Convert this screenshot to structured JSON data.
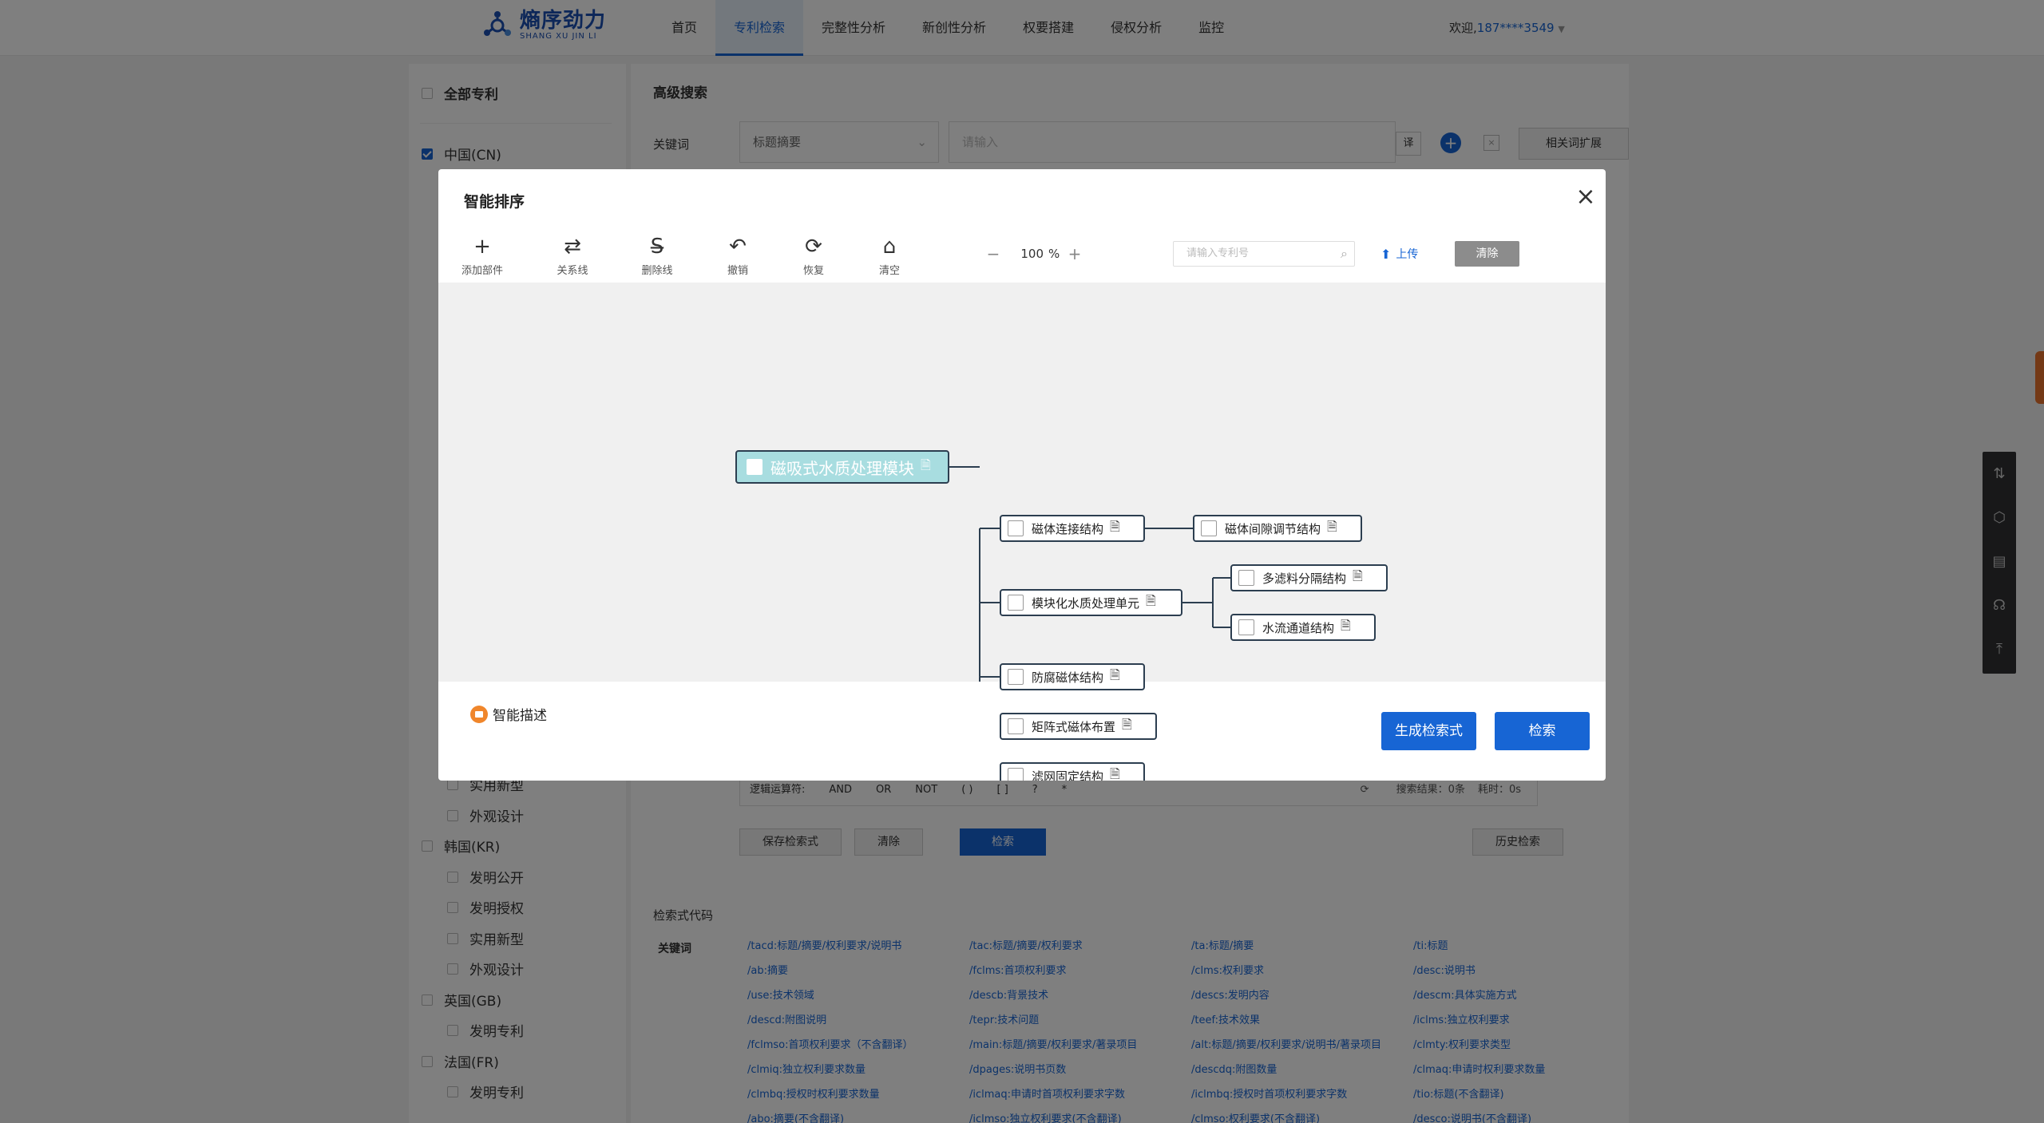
{
  "header": {
    "logo_cn": "熵序劲力",
    "logo_en": "SHANG XU JIN LI",
    "nav": [
      "首页",
      "专利检索",
      "完整性分析",
      "新创性分析",
      "权要搭建",
      "侵权分析",
      "监控"
    ],
    "welcome": "欢迎,",
    "user": "187****3549"
  },
  "sidebar": {
    "all": "全部专利",
    "cn": "中国(CN)",
    "items_lower": [
      {
        "label": "实用新型",
        "indent": true
      },
      {
        "label": "外观设计",
        "indent": true
      },
      {
        "label": "韩国(KR)",
        "indent": false
      },
      {
        "label": "发明公开",
        "indent": true
      },
      {
        "label": "发明授权",
        "indent": true
      },
      {
        "label": "实用新型",
        "indent": true
      },
      {
        "label": "外观设计",
        "indent": true
      },
      {
        "label": "英国(GB)",
        "indent": false
      },
      {
        "label": "发明专利",
        "indent": true
      },
      {
        "label": "法国(FR)",
        "indent": false
      },
      {
        "label": "发明专利",
        "indent": true
      }
    ]
  },
  "main": {
    "adv_title": "高级搜索",
    "kw_label": "关键词",
    "kw_select": "标题摘要",
    "kw_placeholder": "请输入",
    "tr": "译",
    "expand": "相关词扩展",
    "ops_label": "逻辑运算符:",
    "ops": [
      "AND",
      "OR",
      "NOT",
      "(  )",
      "[  ]",
      "?",
      "*"
    ],
    "ops_result": "搜索结果：0条",
    "ops_time": "耗时：0s",
    "save": "保存检索式",
    "clear": "清除",
    "search": "检索",
    "history": "历史检索",
    "code_title": "检索式代码",
    "code_label": "关键词",
    "codes": [
      "/tacd:标题/摘要/权利要求/说明书",
      "/tac:标题/摘要/权利要求",
      "/ta:标题/摘要",
      "/ti:标题",
      "/ab:摘要",
      "/fclms:首项权利要求",
      "/clms:权利要求",
      "/desc:说明书",
      "/use:技术领域",
      "/descb:背景技术",
      "/descs:发明内容",
      "/descm:具体实施方式",
      "/descd:附图说明",
      "/tepr:技术问题",
      "/teef:技术效果",
      "/iclms:独立权利要求",
      "/fclmso:首项权利要求（不含翻译）",
      "/main:标题/摘要/权利要求/著录项目",
      "/alt:标题/摘要/权利要求/说明书/著录项目",
      "/clmty:权利要求类型",
      "/clmiq:独立权利要求数量",
      "/dpages:说明书页数",
      "/descdq:附图数量",
      "/clmaq:申请时权利要求数量",
      "/clmbq:授权时权利要求数量",
      "/iclmaq:申请时首项权利要求字数",
      "/iclmbq:授权时首项权利要求字数",
      "/tio:标题(不含翻译)",
      "/abo:摘要(不含翻译)",
      "/iclmso:独立权利要求(不含翻译)",
      "/clmso:权利要求(不含翻译)",
      "/desco:说明书(不含翻译)"
    ]
  },
  "modal": {
    "title": "智能排序",
    "close": "×",
    "tools": [
      {
        "icon": "add-icon",
        "glyph": "+",
        "label": "添加部件"
      },
      {
        "icon": "relation-line-icon",
        "glyph": "⇄",
        "label": "关系线"
      },
      {
        "icon": "delete-line-icon",
        "glyph": "S̶",
        "label": "删除线"
      },
      {
        "icon": "undo-icon",
        "glyph": "↶",
        "label": "撤销"
      },
      {
        "icon": "restore-icon",
        "glyph": "⟳",
        "label": "恢复"
      },
      {
        "icon": "clear-icon",
        "glyph": "⌂",
        "label": "清空"
      }
    ],
    "zoom_minus": "−",
    "zoom_value": "100",
    "zoom_unit": "%",
    "zoom_plus": "+",
    "patent_placeholder": "请输入专利号",
    "upload": "上传",
    "clear_btn": "清除",
    "mindmap": {
      "root": "磁吸式水质处理模块",
      "children": [
        {
          "label": "磁体连接结构",
          "children": [
            {
              "label": "磁体间隙调节结构"
            }
          ]
        },
        {
          "label": "模块化水质处理单元",
          "children": [
            {
              "label": "多滤料分隔结构"
            },
            {
              "label": "水流通道结构"
            }
          ]
        },
        {
          "label": "防腐磁体结构",
          "children": []
        },
        {
          "label": "矩阵式磁体布置",
          "children": []
        },
        {
          "label": "滤网固定结构",
          "children": []
        }
      ]
    },
    "smart_desc": "智能描述",
    "gen_btn": "生成检索式",
    "search_btn": "检索"
  }
}
